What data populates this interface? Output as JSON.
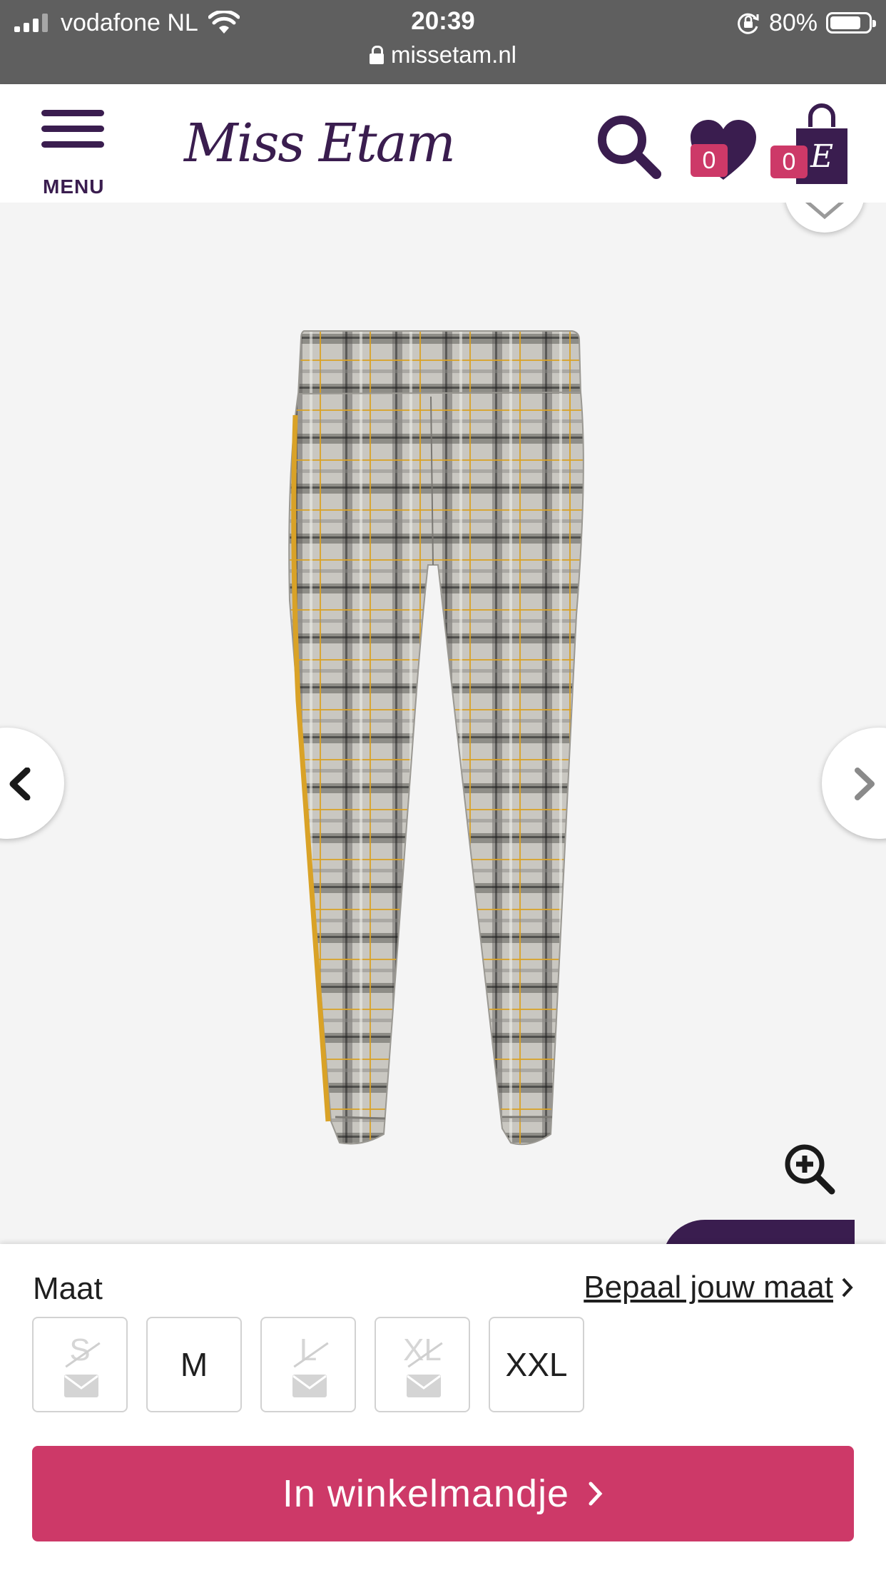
{
  "status_bar": {
    "carrier": "vodafone NL",
    "time": "20:39",
    "battery_percent": "80%",
    "battery_level": 0.8,
    "url": "missetam.nl"
  },
  "header": {
    "menu_label": "MENU",
    "logo_text": "Miss Etam",
    "wishlist_count": "0",
    "cart_count": "0"
  },
  "product": {
    "image_icon": "plaid-pants",
    "nav_prev_icon": "chevron-left-icon",
    "nav_next_icon": "chevron-right-icon"
  },
  "size_selector": {
    "label": "Maat",
    "size_guide_link": "Bepaal jouw maat",
    "sizes": [
      {
        "label": "S",
        "available": false
      },
      {
        "label": "M",
        "available": true
      },
      {
        "label": "L",
        "available": false
      },
      {
        "label": "XL",
        "available": false
      },
      {
        "label": "XXL",
        "available": true
      }
    ]
  },
  "actions": {
    "add_to_cart_label": "In winkelmandje"
  },
  "colors": {
    "brand_purple": "#3a1d4f",
    "accent_pink": "#cd3968",
    "status_gray": "#5f5f5f"
  }
}
